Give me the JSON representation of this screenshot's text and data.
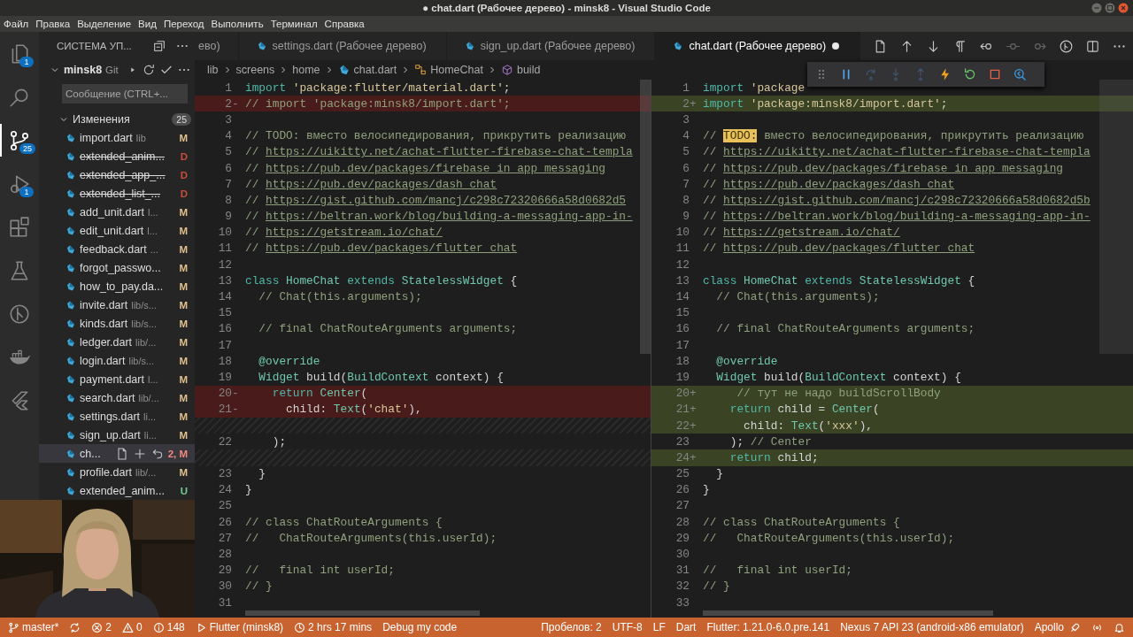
{
  "window": {
    "title": "● chat.dart (Рабочее дерево) - minsk8 - Visual Studio Code"
  },
  "menu": [
    "Файл",
    "Правка",
    "Выделение",
    "Вид",
    "Переход",
    "Выполнить",
    "Терминал",
    "Справка"
  ],
  "activity_bar": [
    {
      "kind": "files",
      "badge": "1",
      "selected": false
    },
    {
      "kind": "search",
      "selected": false
    },
    {
      "kind": "scm",
      "badge": "25",
      "selected": true
    },
    {
      "kind": "debug",
      "badge": "1",
      "selected": false
    },
    {
      "kind": "extensions",
      "selected": false
    },
    {
      "kind": "flask",
      "selected": false
    },
    {
      "kind": "graph",
      "selected": false
    },
    {
      "kind": "docker",
      "selected": false
    },
    {
      "kind": "flutter",
      "selected": false
    }
  ],
  "sidebar": {
    "title": "СИСТЕМА УП...",
    "repo": {
      "name": "minsk8",
      "type": "Git"
    },
    "message": {
      "placeholder": "Сообщение (CTRL+..."
    },
    "changes": {
      "label": "Изменения",
      "count": "25",
      "expanded": true,
      "items": [
        {
          "name": "import.dart",
          "path": "lib",
          "status": "M",
          "kind": "modified",
          "selected": false
        },
        {
          "name": "extended_anim...",
          "status": "D",
          "kind": "deleted",
          "selected": false
        },
        {
          "name": "extended_app_...",
          "status": "D",
          "kind": "deleted",
          "selected": false
        },
        {
          "name": "extended_list_...",
          "status": "D",
          "kind": "deleted",
          "selected": false
        },
        {
          "name": "add_unit.dart",
          "path": "l...",
          "status": "M",
          "kind": "modified",
          "selected": false
        },
        {
          "name": "edit_unit.dart",
          "path": "l...",
          "status": "M",
          "kind": "modified",
          "selected": false
        },
        {
          "name": "feedback.dart",
          "path": "...",
          "status": "M",
          "kind": "modified",
          "selected": false
        },
        {
          "name": "forgot_passwo...",
          "status": "M",
          "kind": "modified",
          "selected": false
        },
        {
          "name": "how_to_pay.da...",
          "status": "M",
          "kind": "modified",
          "selected": false
        },
        {
          "name": "invite.dart",
          "path": "lib/s...",
          "status": "M",
          "kind": "modified",
          "selected": false
        },
        {
          "name": "kinds.dart",
          "path": "lib/s...",
          "status": "M",
          "kind": "modified",
          "selected": false
        },
        {
          "name": "ledger.dart",
          "path": "lib/...",
          "status": "M",
          "kind": "modified",
          "selected": false
        },
        {
          "name": "login.dart",
          "path": "lib/s...",
          "status": "M",
          "kind": "modified",
          "selected": false
        },
        {
          "name": "payment.dart",
          "path": "l...",
          "status": "M",
          "kind": "modified",
          "selected": false
        },
        {
          "name": "search.dart",
          "path": "lib/...",
          "status": "M",
          "kind": "modified",
          "selected": false
        },
        {
          "name": "settings.dart",
          "path": "li...",
          "status": "M",
          "kind": "modified",
          "selected": false
        },
        {
          "name": "sign_up.dart",
          "path": "li...",
          "status": "M",
          "kind": "modified",
          "selected": false
        },
        {
          "name": "ch...",
          "status": "2, M",
          "kind": "problem",
          "selected": true
        },
        {
          "name": "profile.dart",
          "path": "lib/...",
          "status": "M",
          "kind": "modified",
          "selected": false
        },
        {
          "name": "extended_anim...",
          "status": "U",
          "kind": "untracked",
          "selected": false
        }
      ]
    }
  },
  "tabs": [
    {
      "label": "ево)",
      "kind": "clipped",
      "selected": false,
      "dirty": false
    },
    {
      "label": "settings.dart (Рабочее дерево)",
      "kind": "file",
      "selected": false,
      "dirty": false
    },
    {
      "label": "sign_up.dart (Рабочее дерево)",
      "kind": "file",
      "selected": false,
      "dirty": false
    },
    {
      "label": "chat.dart (Рабочее дерево)",
      "kind": "file",
      "selected": true,
      "dirty": true
    }
  ],
  "editor_actions": [
    {
      "kind": "open-file",
      "disabled": false
    },
    {
      "kind": "arrow-up",
      "disabled": false
    },
    {
      "kind": "arrow-down",
      "disabled": false
    },
    {
      "kind": "pilcrow",
      "disabled": false
    },
    {
      "kind": "prev-change",
      "disabled": false
    },
    {
      "kind": "circle-dot",
      "disabled": true
    },
    {
      "kind": "next-change",
      "disabled": true
    },
    {
      "kind": "git-compare",
      "disabled": false
    },
    {
      "kind": "split",
      "disabled": false
    },
    {
      "kind": "more",
      "disabled": false
    }
  ],
  "breadcrumbs": [
    {
      "text": "lib",
      "kind": "folder"
    },
    {
      "text": "screens",
      "kind": "folder"
    },
    {
      "text": "home",
      "kind": "folder"
    },
    {
      "text": "chat.dart",
      "kind": "file"
    },
    {
      "text": "HomeChat",
      "kind": "class"
    },
    {
      "text": "build",
      "kind": "method"
    }
  ],
  "debug_toolbar": [
    {
      "kind": "grip",
      "disabled": false
    },
    {
      "kind": "pause",
      "disabled": false
    },
    {
      "kind": "step-over",
      "disabled": true
    },
    {
      "kind": "step-into",
      "disabled": true
    },
    {
      "kind": "step-out",
      "disabled": true
    },
    {
      "kind": "bolt",
      "disabled": false
    },
    {
      "kind": "restart",
      "disabled": false
    },
    {
      "kind": "stop",
      "disabled": false
    },
    {
      "kind": "inspect",
      "disabled": false
    }
  ],
  "diff": {
    "left": [
      {
        "n": "1",
        "kind": "normal",
        "segs": [
          {
            "kind": "keyword",
            "text": "import "
          },
          {
            "kind": "string",
            "text": "'package:flutter/material.dart'"
          },
          {
            "kind": "plain",
            "text": ";"
          }
        ]
      },
      {
        "n": "2",
        "mark": "-",
        "kind": "removed",
        "segs": [
          {
            "kind": "comment",
            "text": "// import 'package:minsk8/import.dart';"
          }
        ]
      },
      {
        "n": "3",
        "kind": "normal"
      },
      {
        "n": "4",
        "kind": "normal",
        "segs": [
          {
            "kind": "comment",
            "text": "// TODO: вместо велосипедирования, прикрутить реализацию"
          }
        ]
      },
      {
        "n": "5",
        "kind": "normal",
        "segs": [
          {
            "kind": "comment",
            "text": "// "
          },
          {
            "kind": "link",
            "text": "https://uikitty.net/achat-flutter-firebase-chat-templa"
          }
        ]
      },
      {
        "n": "6",
        "kind": "normal",
        "segs": [
          {
            "kind": "comment",
            "text": "// "
          },
          {
            "kind": "link",
            "text": "https://pub.dev/packages/firebase_in_app_messaging"
          }
        ]
      },
      {
        "n": "7",
        "kind": "normal",
        "segs": [
          {
            "kind": "comment",
            "text": "// "
          },
          {
            "kind": "link",
            "text": "https://pub.dev/packages/dash_chat"
          }
        ]
      },
      {
        "n": "8",
        "kind": "normal",
        "segs": [
          {
            "kind": "comment",
            "text": "// "
          },
          {
            "kind": "link",
            "text": "https://gist.github.com/mancj/c298c72320666a58d0682d5"
          }
        ]
      },
      {
        "n": "9",
        "kind": "normal",
        "segs": [
          {
            "kind": "comment",
            "text": "// "
          },
          {
            "kind": "link",
            "text": "https://beltran.work/blog/building-a-messaging-app-in-"
          }
        ]
      },
      {
        "n": "10",
        "kind": "normal",
        "segs": [
          {
            "kind": "comment",
            "text": "// "
          },
          {
            "kind": "link",
            "text": "https://getstream.io/chat/"
          }
        ]
      },
      {
        "n": "11",
        "kind": "normal",
        "segs": [
          {
            "kind": "comment",
            "text": "// "
          },
          {
            "kind": "link",
            "text": "https://pub.dev/packages/flutter_chat"
          }
        ]
      },
      {
        "n": "12",
        "kind": "normal"
      },
      {
        "n": "13",
        "kind": "normal",
        "segs": [
          {
            "kind": "keyword",
            "text": "class "
          },
          {
            "kind": "type",
            "text": "HomeChat"
          },
          {
            "kind": "keyword",
            "text": " extends "
          },
          {
            "kind": "type",
            "text": "StatelessWidget"
          },
          {
            "kind": "plain",
            "text": " {"
          }
        ]
      },
      {
        "n": "14",
        "kind": "normal",
        "segs": [
          {
            "kind": "comment",
            "text": "  // Chat(this.arguments);"
          }
        ]
      },
      {
        "n": "15",
        "kind": "normal"
      },
      {
        "n": "16",
        "kind": "normal",
        "segs": [
          {
            "kind": "comment",
            "text": "  // final ChatRouteArguments arguments;"
          }
        ]
      },
      {
        "n": "17",
        "kind": "normal"
      },
      {
        "n": "18",
        "kind": "normal",
        "segs": [
          {
            "kind": "annotation",
            "text": "  @override"
          }
        ]
      },
      {
        "n": "19",
        "kind": "normal",
        "segs": [
          {
            "kind": "type",
            "text": "  Widget"
          },
          {
            "kind": "plain",
            "text": " build("
          },
          {
            "kind": "type",
            "text": "BuildContext"
          },
          {
            "kind": "plain",
            "text": " context) {"
          }
        ]
      },
      {
        "n": "20",
        "mark": "-",
        "kind": "removed",
        "segs": [
          {
            "kind": "keyword",
            "text": "    return "
          },
          {
            "kind": "type",
            "text": "Center"
          },
          {
            "kind": "plain",
            "text": "("
          }
        ]
      },
      {
        "n": "21",
        "mark": "-",
        "kind": "removed",
        "segs": [
          {
            "kind": "plain",
            "text": "      child: "
          },
          {
            "kind": "type",
            "text": "Text"
          },
          {
            "kind": "plain",
            "text": "("
          },
          {
            "kind": "string",
            "text": "'chat'"
          },
          {
            "kind": "plain",
            "text": "),"
          }
        ]
      },
      {
        "kind": "filler"
      },
      {
        "n": "22",
        "kind": "normal",
        "segs": [
          {
            "kind": "plain",
            "text": "    );"
          }
        ]
      },
      {
        "kind": "filler"
      },
      {
        "n": "23",
        "kind": "normal",
        "segs": [
          {
            "kind": "plain",
            "text": "  }"
          }
        ]
      },
      {
        "n": "24",
        "kind": "normal",
        "segs": [
          {
            "kind": "plain",
            "text": "}"
          }
        ]
      },
      {
        "n": "25",
        "kind": "normal"
      },
      {
        "n": "26",
        "kind": "normal",
        "segs": [
          {
            "kind": "comment",
            "text": "// class ChatRouteArguments {"
          }
        ]
      },
      {
        "n": "27",
        "kind": "normal",
        "segs": [
          {
            "kind": "comment",
            "text": "//   ChatRouteArguments(this.userId);"
          }
        ]
      },
      {
        "n": "28",
        "kind": "normal"
      },
      {
        "n": "29",
        "kind": "normal",
        "segs": [
          {
            "kind": "comment",
            "text": "//   final int userId;"
          }
        ]
      },
      {
        "n": "30",
        "kind": "normal",
        "segs": [
          {
            "kind": "comment",
            "text": "// }"
          }
        ]
      },
      {
        "n": "31",
        "kind": "normal"
      }
    ],
    "right": [
      {
        "n": "1",
        "kind": "normal",
        "segs": [
          {
            "kind": "keyword",
            "text": "import "
          },
          {
            "kind": "string",
            "text": "'package"
          }
        ]
      },
      {
        "n": "2",
        "mark": "+",
        "kind": "added",
        "segs": [
          {
            "kind": "keyword",
            "text": "import "
          },
          {
            "kind": "string",
            "text": "'package:minsk8/import.dart'"
          },
          {
            "kind": "plain",
            "text": ";"
          }
        ]
      },
      {
        "n": "3",
        "kind": "normal"
      },
      {
        "n": "4",
        "kind": "normal",
        "segs": [
          {
            "kind": "comment",
            "text": "// "
          },
          {
            "kind": "highlight",
            "text": "TODO:"
          },
          {
            "kind": "comment",
            "text": " вместо велосипедирования, прикрутить реализацию"
          }
        ]
      },
      {
        "n": "5",
        "kind": "normal",
        "segs": [
          {
            "kind": "comment",
            "text": "// "
          },
          {
            "kind": "link",
            "text": "https://uikitty.net/achat-flutter-firebase-chat-templa"
          }
        ]
      },
      {
        "n": "6",
        "kind": "normal",
        "segs": [
          {
            "kind": "comment",
            "text": "// "
          },
          {
            "kind": "link",
            "text": "https://pub.dev/packages/firebase_in_app_messaging"
          }
        ]
      },
      {
        "n": "7",
        "kind": "normal",
        "segs": [
          {
            "kind": "comment",
            "text": "// "
          },
          {
            "kind": "link",
            "text": "https://pub.dev/packages/dash_chat"
          }
        ]
      },
      {
        "n": "8",
        "kind": "normal",
        "segs": [
          {
            "kind": "comment",
            "text": "// "
          },
          {
            "kind": "link",
            "text": "https://gist.github.com/mancj/c298c72320666a58d0682d5b"
          }
        ]
      },
      {
        "n": "9",
        "kind": "normal",
        "segs": [
          {
            "kind": "comment",
            "text": "// "
          },
          {
            "kind": "link",
            "text": "https://beltran.work/blog/building-a-messaging-app-in-"
          }
        ]
      },
      {
        "n": "10",
        "kind": "normal",
        "segs": [
          {
            "kind": "comment",
            "text": "// "
          },
          {
            "kind": "link",
            "text": "https://getstream.io/chat/"
          }
        ]
      },
      {
        "n": "11",
        "kind": "normal",
        "segs": [
          {
            "kind": "comment",
            "text": "// "
          },
          {
            "kind": "link",
            "text": "https://pub.dev/packages/flutter_chat"
          }
        ]
      },
      {
        "n": "12",
        "kind": "normal"
      },
      {
        "n": "13",
        "kind": "normal",
        "segs": [
          {
            "kind": "keyword",
            "text": "class "
          },
          {
            "kind": "type",
            "text": "HomeChat"
          },
          {
            "kind": "keyword",
            "text": " extends "
          },
          {
            "kind": "type",
            "text": "StatelessWidget"
          },
          {
            "kind": "plain",
            "text": " {"
          }
        ]
      },
      {
        "n": "14",
        "kind": "normal",
        "segs": [
          {
            "kind": "comment",
            "text": "  // Chat(this.arguments);"
          }
        ]
      },
      {
        "n": "15",
        "kind": "normal"
      },
      {
        "n": "16",
        "kind": "normal",
        "segs": [
          {
            "kind": "comment",
            "text": "  // final ChatRouteArguments arguments;"
          }
        ]
      },
      {
        "n": "17",
        "kind": "normal"
      },
      {
        "n": "18",
        "kind": "normal",
        "segs": [
          {
            "kind": "annotation",
            "text": "  @override"
          }
        ]
      },
      {
        "n": "19",
        "kind": "normal",
        "segs": [
          {
            "kind": "type",
            "text": "  Widget"
          },
          {
            "kind": "plain",
            "text": " build("
          },
          {
            "kind": "type",
            "text": "BuildContext"
          },
          {
            "kind": "plain",
            "text": " context) {"
          }
        ]
      },
      {
        "n": "20",
        "mark": "+",
        "kind": "added",
        "segs": [
          {
            "kind": "comment",
            "text": "     // тут не надо buildScrollBody"
          }
        ]
      },
      {
        "n": "21",
        "mark": "+",
        "kind": "added",
        "segs": [
          {
            "kind": "keyword",
            "text": "    return "
          },
          {
            "kind": "plain",
            "text": "child = "
          },
          {
            "kind": "type",
            "text": "Center"
          },
          {
            "kind": "plain",
            "text": "("
          }
        ]
      },
      {
        "n": "22",
        "mark": "+",
        "kind": "added",
        "segs": [
          {
            "kind": "plain",
            "text": "      child: "
          },
          {
            "kind": "type",
            "text": "Text"
          },
          {
            "kind": "plain",
            "text": "("
          },
          {
            "kind": "string",
            "text": "'xxx'"
          },
          {
            "kind": "plain",
            "text": "),"
          }
        ]
      },
      {
        "n": "23",
        "kind": "normal",
        "segs": [
          {
            "kind": "plain",
            "text": "    ); "
          },
          {
            "kind": "comment",
            "text": "// Center"
          }
        ]
      },
      {
        "n": "24",
        "mark": "+",
        "kind": "added",
        "segs": [
          {
            "kind": "keyword",
            "text": "    return "
          },
          {
            "kind": "plain",
            "text": "child;"
          }
        ]
      },
      {
        "n": "25",
        "kind": "normal",
        "segs": [
          {
            "kind": "plain",
            "text": "  }"
          }
        ]
      },
      {
        "n": "26",
        "kind": "normal",
        "segs": [
          {
            "kind": "plain",
            "text": "}"
          }
        ]
      },
      {
        "n": "27",
        "kind": "normal"
      },
      {
        "n": "28",
        "kind": "normal",
        "segs": [
          {
            "kind": "comment",
            "text": "// class ChatRouteArguments {"
          }
        ]
      },
      {
        "n": "29",
        "kind": "normal",
        "segs": [
          {
            "kind": "comment",
            "text": "//   ChatRouteArguments(this.userId);"
          }
        ]
      },
      {
        "n": "30",
        "kind": "normal"
      },
      {
        "n": "31",
        "kind": "normal",
        "segs": [
          {
            "kind": "comment",
            "text": "//   final int userId;"
          }
        ]
      },
      {
        "n": "32",
        "kind": "normal",
        "segs": [
          {
            "kind": "comment",
            "text": "// }"
          }
        ]
      },
      {
        "n": "33",
        "kind": "normal"
      }
    ]
  },
  "status_bar": {
    "left": [
      {
        "kind": "branch",
        "text": "master*"
      },
      {
        "kind": "sync"
      },
      {
        "kind": "errors",
        "text": "2"
      },
      {
        "kind": "warnings",
        "text": "0"
      },
      {
        "kind": "infos",
        "text": "148"
      },
      {
        "kind": "run",
        "text": "Flutter (minsk8)"
      },
      {
        "kind": "timer",
        "text": "2 hrs 17 mins"
      },
      {
        "kind": "plain",
        "text": "Debug my code"
      }
    ],
    "right": [
      {
        "kind": "plain",
        "text": "Пробелов: 2"
      },
      {
        "kind": "plain",
        "text": "UTF-8"
      },
      {
        "kind": "plain",
        "text": "LF"
      },
      {
        "kind": "plain",
        "text": "Dart"
      },
      {
        "kind": "plain",
        "text": "Flutter: 1.21.0-6.0.pre.141"
      },
      {
        "kind": "plain",
        "text": "Nexus 7 API 23 (android-x86 emulator)"
      },
      {
        "kind": "deploy",
        "text": "Apollo"
      },
      {
        "kind": "live"
      },
      {
        "kind": "notifications"
      }
    ]
  }
}
